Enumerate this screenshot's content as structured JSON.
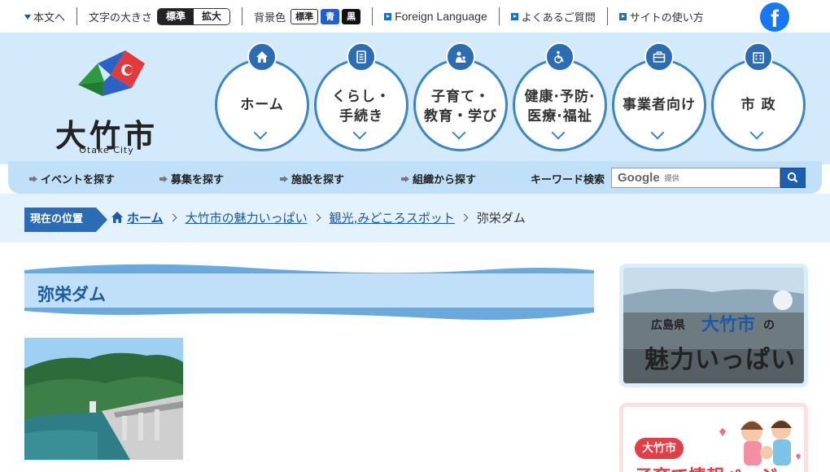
{
  "topbar": {
    "skip_label": "本文へ",
    "font_size_label": "文字の大きさ",
    "font_size_standard": "標準",
    "font_size_large": "拡大",
    "bg_label": "背景色",
    "bg_standard": "標準",
    "bg_blue": "青",
    "bg_black": "黒",
    "foreign_language": "Foreign Language",
    "faq": "よくあるご質問",
    "how_to_use": "サイトの使い方",
    "facebook_icon": "facebook-icon"
  },
  "logo": {
    "title": "大竹市",
    "subtitle": "Otake City"
  },
  "nav": {
    "home": "ホーム",
    "living": "くらし・\n手続き",
    "childcare": "子育て・\n教育・学び",
    "health": "健康·予防·\n医療·福祉",
    "business": "事業者向け",
    "city": "市 政"
  },
  "subnav": {
    "events": "イベントを探す",
    "recruit": "募集を探す",
    "facilities": "施設を探す",
    "organizations": "組織から探す",
    "keyword_label": "キーワード検索",
    "search_brand": "Google",
    "search_provided": "提供"
  },
  "breadcrumb": {
    "label": "現在の位置",
    "home": "ホーム",
    "level1": "大竹市の魅力いっぱい",
    "level2": "観光,みどころスポット",
    "current": "弥栄ダム"
  },
  "main": {
    "title": "弥栄ダム"
  },
  "sidebar": {
    "banner1_prefix": "広島県",
    "banner1_city": "大竹市",
    "banner1_no": "の",
    "banner1_main": "魅力いっぱい",
    "banner2_badge": "大竹市",
    "banner2_text": "子育て情報ページ"
  },
  "colors": {
    "primary": "#2a6db4",
    "header_bg": "#d2eafb",
    "accent_red": "#e53d48"
  }
}
